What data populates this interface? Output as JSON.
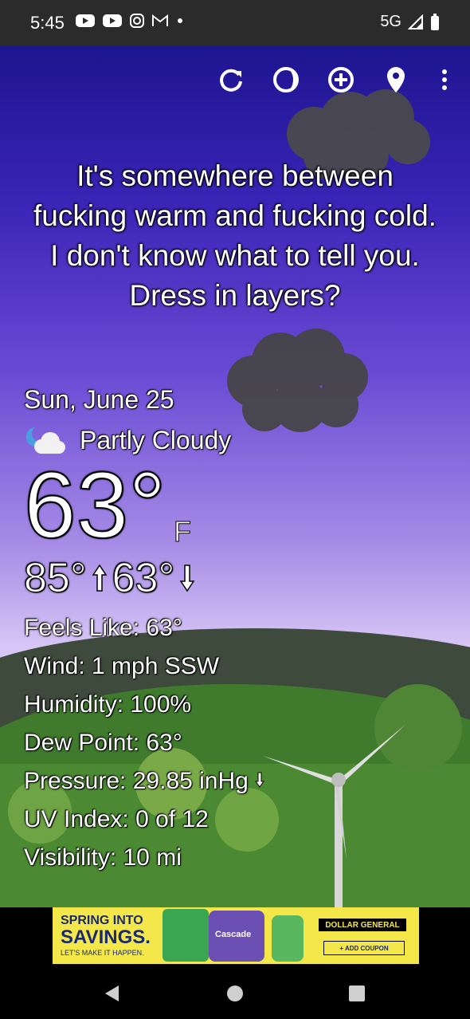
{
  "status_bar": {
    "time": "5:45",
    "network": "5G",
    "notification_icons": [
      "youtube-icon",
      "youtube-icon",
      "instagram-icon",
      "gmail-icon",
      "dot-icon"
    ]
  },
  "toolbar": {
    "buttons": [
      "refresh-icon",
      "theme-icon",
      "add-location-icon",
      "location-pin-icon",
      "more-vert-icon"
    ]
  },
  "headline": "It's somewhere between fucking warm and fucking cold. I don't know what to tell you. Dress in layers?",
  "weather": {
    "date": "Sun, June 25",
    "condition": "Partly Cloudy",
    "condition_icon": "partly-cloudy-night-icon",
    "temperature": "63°",
    "unit": "F",
    "high": "85°",
    "low": "63°",
    "details": {
      "feels_like_label": "Feels Like:",
      "feels_like": "63°",
      "wind_label": "Wind:",
      "wind": "1 mph SSW",
      "humidity_label": "Humidity:",
      "humidity": "100%",
      "dew_point_label": "Dew Point:",
      "dew_point": "63°",
      "pressure_label": "Pressure:",
      "pressure": "29.85 inHg",
      "uv_label": "UV Index:",
      "uv": "0 of 12",
      "visibility_label": "Visibility:",
      "visibility": "10 mi"
    }
  },
  "ad": {
    "line1": "SPRING INTO",
    "line2": "SAVINGS.",
    "line3": "LET'S MAKE IT HAPPEN.",
    "brand": "DOLLAR GENERAL",
    "cta": "+ ADD COUPON",
    "product_label": "Cascade"
  },
  "colors": {
    "sky_top": "#1d1590",
    "sky_bottom": "#d8c7f6",
    "grass": "#4b8a32",
    "status_bar": "#2b2b2b"
  }
}
